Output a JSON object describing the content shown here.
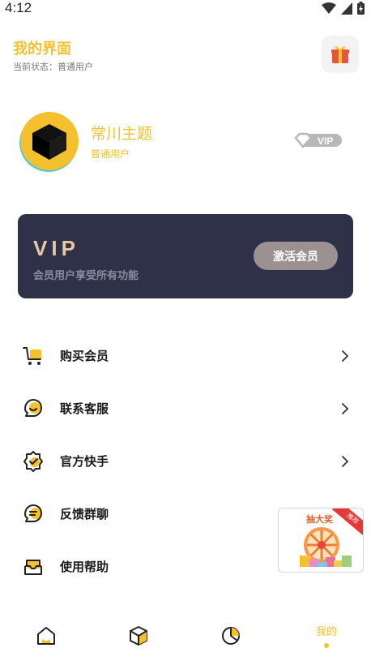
{
  "status_bar": {
    "time": "4:12"
  },
  "header": {
    "title": "我的界面",
    "subtitle": "当前状态：普通用户"
  },
  "profile": {
    "name": "常川主题",
    "level": "普通用户",
    "badge": "VIP"
  },
  "vip_card": {
    "title": "VIP",
    "description": "会员用户享受所有功能",
    "button_label": "激活会员"
  },
  "menu": [
    {
      "label": "购买会员",
      "icon": "cart-icon"
    },
    {
      "label": "联系客服",
      "icon": "customer-service-icon"
    },
    {
      "label": "官方快手",
      "icon": "verified-badge-icon"
    },
    {
      "label": "反馈群聊",
      "icon": "feedback-chat-icon"
    },
    {
      "label": "使用帮助",
      "icon": "inbox-help-icon"
    }
  ],
  "promo": {
    "title": "抽大奖",
    "tag": "推荐"
  },
  "bottom_nav": {
    "items": [
      {
        "icon": "home-icon"
      },
      {
        "icon": "box-icon"
      },
      {
        "icon": "pie-chart-icon"
      },
      {
        "label": "我的"
      }
    ],
    "active_index": 3
  },
  "colors": {
    "accent": "#f2c230",
    "card_bg": "#2e3147",
    "vip_gold": "#e6c9a4"
  }
}
